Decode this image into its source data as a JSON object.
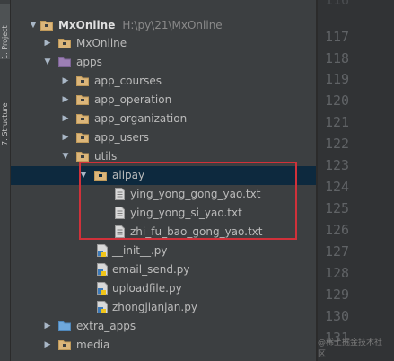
{
  "tool_tabs": {
    "project_label": "1: Project",
    "structure_label": "7: Structure"
  },
  "project_tree": {
    "root": {
      "name": "MxOnline",
      "path": "H:\\py\\21\\MxOnline"
    },
    "items": [
      {
        "label": "MxOnline",
        "type": "folder",
        "state": "collapsed"
      },
      {
        "label": "apps",
        "type": "package",
        "state": "expanded"
      },
      {
        "label": "app_courses",
        "type": "package",
        "state": "collapsed"
      },
      {
        "label": "app_operation",
        "type": "package",
        "state": "collapsed"
      },
      {
        "label": "app_organization",
        "type": "package",
        "state": "collapsed"
      },
      {
        "label": "app_users",
        "type": "package",
        "state": "collapsed"
      },
      {
        "label": "utils",
        "type": "package",
        "state": "expanded"
      },
      {
        "label": "alipay",
        "type": "package",
        "state": "expanded",
        "selected": true
      },
      {
        "label": "ying_yong_gong_yao.txt",
        "type": "text-file"
      },
      {
        "label": "ying_yong_si_yao.txt",
        "type": "text-file"
      },
      {
        "label": "zhi_fu_bao_gong_yao.txt",
        "type": "text-file"
      },
      {
        "label": "__init__.py",
        "type": "python-file"
      },
      {
        "label": "email_send.py",
        "type": "python-file"
      },
      {
        "label": "uploadfile.py",
        "type": "python-file"
      },
      {
        "label": "zhongjianjan.py",
        "type": "python-file"
      },
      {
        "label": "extra_apps",
        "type": "folder",
        "state": "collapsed"
      },
      {
        "label": "media",
        "type": "folder",
        "state": "collapsed"
      }
    ]
  },
  "editor": {
    "line_numbers": [
      "116",
      "117",
      "118",
      "119",
      "120",
      "121",
      "122",
      "123",
      "124",
      "125",
      "126",
      "127",
      "128",
      "129",
      "130",
      "131"
    ]
  },
  "colors": {
    "highlight_border": "#d0313a",
    "selection_bg": "#0d293e"
  },
  "watermark": "@稀土掘金技术社区"
}
